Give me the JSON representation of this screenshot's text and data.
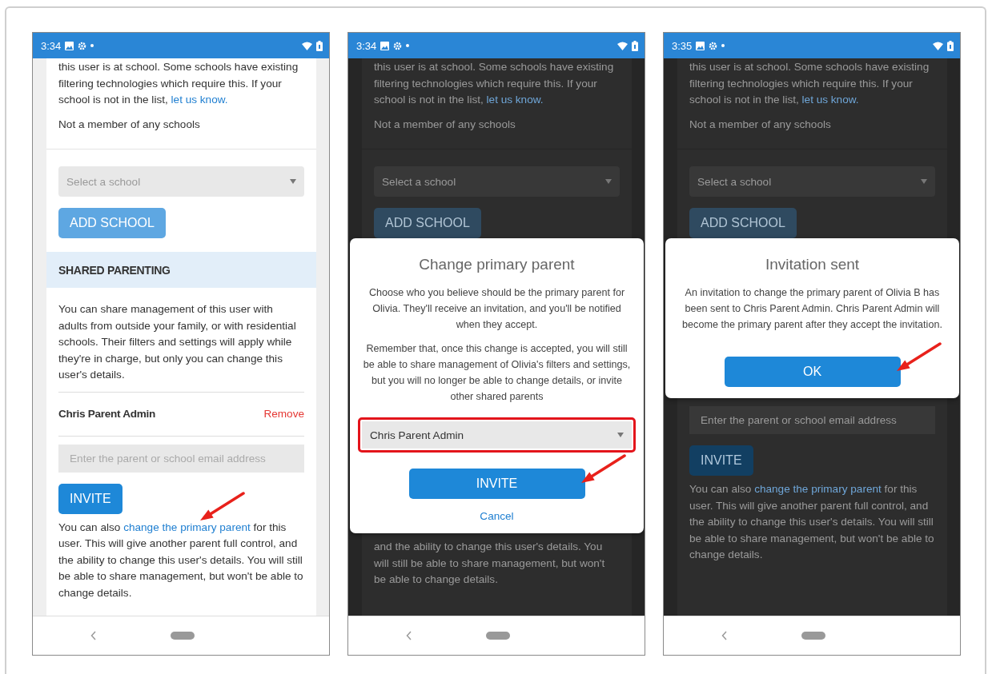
{
  "phones": [
    {
      "status_time": "3:34",
      "dimmed": false,
      "screen": [
        {
          "kind": "text",
          "parts": [
            {
              "text": "this user is at school. Some schools have existing filtering technologies which require this. If your school is not in the list, ",
              "link": false
            },
            {
              "text": "let us know.",
              "link": true
            }
          ]
        },
        {
          "kind": "text",
          "parts": [
            {
              "text": "Not a member of any schools",
              "link": false
            }
          ]
        },
        {
          "kind": "divider"
        },
        {
          "kind": "select",
          "placeholder": "Select a school"
        },
        {
          "kind": "button",
          "label": "ADD SCHOOL",
          "disabled": true
        },
        {
          "kind": "section_header",
          "label": "SHARED PARENTING"
        },
        {
          "kind": "text",
          "parts": [
            {
              "text": "You can share management of this user with adults from outside your family, or with residential schools. Their filters and settings will apply while they're in charge, but only you can change this user's details.",
              "link": false
            }
          ]
        },
        {
          "kind": "member",
          "name": "Chris Parent Admin",
          "action": "Remove"
        },
        {
          "kind": "field",
          "placeholder": "Enter the parent or school email address"
        },
        {
          "kind": "button",
          "label": "INVITE",
          "disabled": false
        },
        {
          "kind": "text",
          "parts": [
            {
              "text": "You can also ",
              "link": false
            },
            {
              "text": "change the primary parent",
              "link": true,
              "arrow": true
            },
            {
              "text": " for this user. This will give another parent full control, and the ability to change this user's details. You will still be able to share management, but won't be able to change details.",
              "link": false
            }
          ]
        }
      ]
    },
    {
      "status_time": "3:34",
      "dimmed": true,
      "screen": [
        {
          "kind": "text",
          "parts": [
            {
              "text": "this user is at school. Some schools have existing filtering technologies which require this. If your school is not in the list, ",
              "link": false
            },
            {
              "text": "let us know.",
              "link": true
            }
          ]
        },
        {
          "kind": "text",
          "parts": [
            {
              "text": "Not a member of any schools",
              "link": false
            }
          ]
        },
        {
          "kind": "divider"
        },
        {
          "kind": "select",
          "placeholder": "Select a school"
        },
        {
          "kind": "button",
          "label": "ADD SCHOOL",
          "disabled": true
        },
        {
          "kind": "dialog",
          "title": "Change primary parent",
          "body": [
            "Choose who you believe should be the primary parent for Olivia. They'll receive an invitation, and you'll be notified when they accept.",
            "Remember that, once this change is accepted, you will still be able to share management of Olivia's filters and settings, but you will no longer be able to change details, or invite other shared parents"
          ],
          "select": {
            "value": "Chris Parent Admin",
            "highlighted": true
          },
          "actions": [
            {
              "kind": "button",
              "label": "INVITE",
              "arrow": true
            },
            {
              "kind": "link",
              "label": "Cancel"
            }
          ]
        },
        {
          "kind": "text",
          "parts": [
            {
              "text": "and the ability to change this user's details. You will still be able to share management, but won't be able to change details.",
              "link": false
            }
          ]
        }
      ]
    },
    {
      "status_time": "3:35",
      "dimmed": true,
      "screen": [
        {
          "kind": "text",
          "parts": [
            {
              "text": "this user is at school. Some schools have existing filtering technologies which require this. If your school is not in the list, ",
              "link": false
            },
            {
              "text": "let us know.",
              "link": true
            }
          ]
        },
        {
          "kind": "text",
          "parts": [
            {
              "text": "Not a member of any schools",
              "link": false
            }
          ]
        },
        {
          "kind": "divider"
        },
        {
          "kind": "select",
          "placeholder": "Select a school"
        },
        {
          "kind": "button",
          "label": "ADD SCHOOL",
          "disabled": true
        },
        {
          "kind": "dialog",
          "title": "Invitation sent",
          "body": [
            "An invitation to change the primary parent of Olivia B has been sent to Chris Parent Admin. Chris Parent Admin will become the primary parent after they accept the invitation."
          ],
          "actions": [
            {
              "kind": "button",
              "label": "OK",
              "arrow": true
            }
          ]
        },
        {
          "kind": "field",
          "placeholder": "Enter the parent or school email address"
        },
        {
          "kind": "button",
          "label": "INVITE",
          "disabled": false
        },
        {
          "kind": "text",
          "parts": [
            {
              "text": "You can also ",
              "link": false
            },
            {
              "text": "change the primary parent",
              "link": true
            },
            {
              "text": " for this user. This will give another parent full control, and the ability to change this user's details. You will still be able to share management, but won't be able to change details.",
              "link": false
            }
          ]
        }
      ]
    }
  ]
}
